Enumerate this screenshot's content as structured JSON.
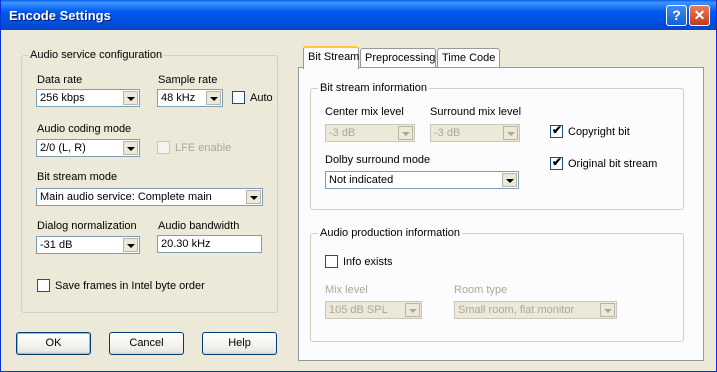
{
  "window": {
    "title": "Encode Settings",
    "help_label": "?",
    "close_label": "✕"
  },
  "audio_service": {
    "group_label": "Audio service configuration",
    "data_rate": {
      "label": "Data rate",
      "value": "256 kbps"
    },
    "sample_rate": {
      "label": "Sample rate",
      "value": "48 kHz"
    },
    "auto_label": "Auto",
    "coding_mode": {
      "label": "Audio coding mode",
      "value": "2/0 (L, R)"
    },
    "lfe_label": "LFE enable",
    "bit_stream_mode": {
      "label": "Bit stream mode",
      "value": "Main audio service: Complete main"
    },
    "dialog_norm": {
      "label": "Dialog normalization",
      "value": "-31 dB"
    },
    "audio_bandwidth": {
      "label": "Audio bandwidth",
      "value": "20.30 kHz"
    },
    "save_frames_label": "Save frames in Intel byte order"
  },
  "tabs": [
    {
      "label": "Bit Stream"
    },
    {
      "label": "Preprocessing"
    },
    {
      "label": "Time Code"
    }
  ],
  "bit_stream_info": {
    "group_label": "Bit stream information",
    "center_mix": {
      "label": "Center mix level",
      "value": "-3 dB"
    },
    "surround_mix": {
      "label": "Surround mix level",
      "value": "-3 dB"
    },
    "copyright_label": "Copyright bit",
    "original_label": "Original bit stream",
    "dolby_surround": {
      "label": "Dolby surround mode",
      "value": "Not indicated"
    }
  },
  "audio_production": {
    "group_label": "Audio production information",
    "info_exists_label": "Info exists",
    "mix_level": {
      "label": "Mix level",
      "value": "105 dB SPL"
    },
    "room_type": {
      "label": "Room type",
      "value": "Small room, flat monitor"
    }
  },
  "buttons": {
    "ok": "OK",
    "cancel": "Cancel",
    "help": "Help"
  },
  "checkbox_mark": "✔"
}
